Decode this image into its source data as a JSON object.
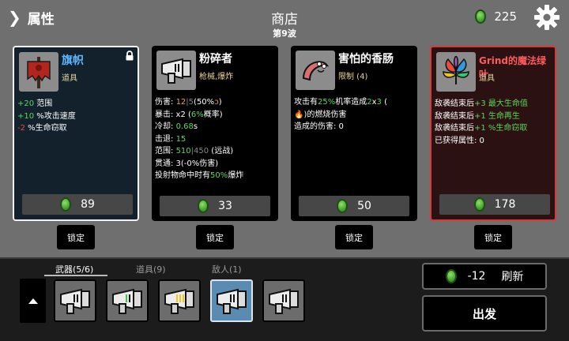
{
  "header": {
    "attributes_label": "属性",
    "title": "商店",
    "wave": "第9波",
    "money": "225"
  },
  "cards": [
    {
      "name": "旗帜",
      "type": "道具",
      "lines": [
        [
          {
            "t": "+20",
            "c": "g"
          },
          {
            "t": " 范围"
          }
        ],
        [
          {
            "t": "+10",
            "c": "g"
          },
          {
            "t": " %攻击速度"
          }
        ],
        [
          {
            "t": "-2",
            "c": "r"
          },
          {
            "t": " %生命窃取"
          }
        ]
      ],
      "price": "89",
      "lock_label": "锁定"
    },
    {
      "name": "粉碎者",
      "type": "枪械,爆炸",
      "lines": [
        [
          {
            "t": "伤害: "
          },
          {
            "t": "12",
            "c": "o"
          },
          {
            "t": "|",
            "c": "dim"
          },
          {
            "t": "5",
            "c": "dim"
          },
          {
            "t": "(50%"
          },
          {
            "t": "ↄ",
            "c": "o"
          },
          {
            "t": ")"
          }
        ],
        [
          {
            "t": "暴击: x2 ("
          },
          {
            "t": "6%",
            "c": "g"
          },
          {
            "t": "概率)"
          }
        ],
        [
          {
            "t": "冷却: "
          },
          {
            "t": "0.68",
            "c": "g"
          },
          {
            "t": "s"
          }
        ],
        [
          {
            "t": "击退: "
          },
          {
            "t": "15",
            "c": "g"
          }
        ],
        [
          {
            "t": "范围: "
          },
          {
            "t": "510",
            "c": "g"
          },
          {
            "t": "|",
            "c": "dim"
          },
          {
            "t": "450",
            "c": "dim"
          },
          {
            "t": " (远战)"
          }
        ],
        [
          {
            "t": "贯通: 3(-0%伤害)"
          }
        ],
        [
          {
            "t": "投射物命中时有"
          },
          {
            "t": "50%",
            "c": "g"
          },
          {
            "t": "爆炸"
          }
        ]
      ],
      "price": "33",
      "lock_label": "锁定"
    },
    {
      "name": "害怕的香肠",
      "type": "限制 (4)",
      "lines": [
        [
          {
            "t": "攻击有"
          },
          {
            "t": "25%",
            "c": "g"
          },
          {
            "t": "机率造成"
          },
          {
            "t": "2",
            "c": "g"
          },
          {
            "t": "x"
          },
          {
            "t": "3",
            "c": "g"
          },
          {
            "t": " ("
          }
        ],
        [
          {
            "t": "🔥",
            "c": "o"
          },
          {
            "t": ")的燃烧伤害"
          }
        ],
        [
          {
            "t": "造成的伤害: 0"
          }
        ]
      ],
      "price": "50",
      "lock_label": "锁定"
    },
    {
      "name": "Grind的魔法绿叶",
      "type": "道具",
      "lines": [
        [
          {
            "t": "敌袭结束后"
          },
          {
            "t": "+3 最大生命值",
            "c": "g"
          }
        ],
        [
          {
            "t": "敌袭结束后"
          },
          {
            "t": "+1 生命再生",
            "c": "g"
          }
        ],
        [
          {
            "t": "敌袭结束后"
          },
          {
            "t": "+1 %生命窃取",
            "c": "g"
          }
        ],
        [
          {
            "t": "已获得属性: 0"
          }
        ]
      ],
      "price": "178",
      "lock_label": "锁定"
    }
  ],
  "tabs": {
    "weapons": "武器(5/6)",
    "items": "道具(9)",
    "enemies": "敌人(1)"
  },
  "refresh": {
    "cost": "-12",
    "label": "刷新"
  },
  "go_label": "出发",
  "icons": {
    "attributes": "chevron-right-icon",
    "currency": "green-material-coin-icon",
    "settings": "gear-icon",
    "lock": "padlock-icon",
    "expand": "arrow-up-icon"
  },
  "colors": {
    "positive": "#5bd85b",
    "negative": "#e84848",
    "item_name": "#5fb7ff",
    "legendary_name": "#ff5b5b",
    "type_label": "#e8d39c",
    "selected_card_border": "#f0f0f0",
    "legendary_border": "#d33a3a"
  }
}
